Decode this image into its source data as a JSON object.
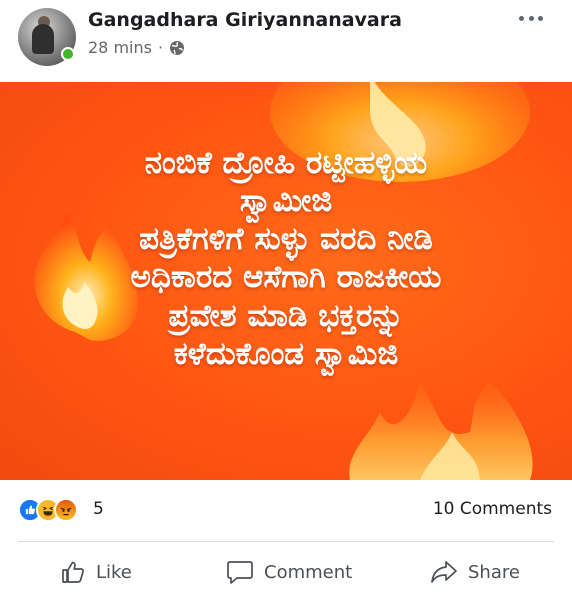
{
  "post": {
    "author": "Gangadhara Giriyannanavara",
    "time": "28 mins",
    "separator": "·",
    "privacy_icon": "globe-icon",
    "more_icon": "more-horizontal-icon"
  },
  "image_text": {
    "lines": [
      "ನಂಬಿಕೆ ದ್ರೋಹಿ ರಟ್ಟೀಹಳ್ಳಿಯ",
      "ಸ್ವಾಮೀಜಿ",
      "ಪತ್ರಿಕೆಗಳಿಗೆ ಸುಳ್ಳು ವರದಿ ನೀಡಿ",
      "ಅಧಿಕಾರದ ಆಸೆಗಾಗಿ ರಾಜಕೀಯ",
      "ಪ್ರವೇಶ ಮಾಡಿ ಭಕ್ತರನ್ನು",
      "ಕಳೆದುಕೊಂಡ ಸ್ವಾಮಿಜಿ"
    ],
    "background_color": "#ff5a14",
    "decoration_icon": "fire-icon"
  },
  "reactions": {
    "types": [
      "like",
      "haha",
      "angry"
    ],
    "count": "5",
    "comments": "10 Comments"
  },
  "actions": {
    "like": "Like",
    "comment": "Comment",
    "share": "Share"
  },
  "colors": {
    "like_blue": "#1877f2",
    "online_green": "#42b72a",
    "muted_text": "#65676b"
  }
}
